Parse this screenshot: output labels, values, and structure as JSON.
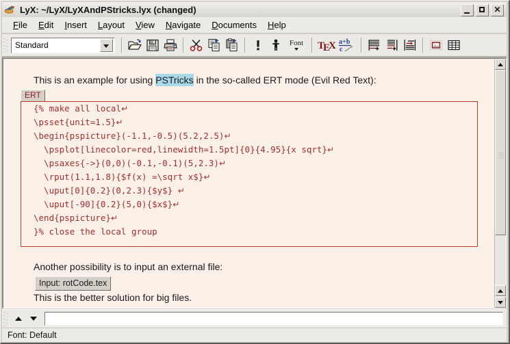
{
  "window": {
    "title": "LyX: ~/LyX/LyXAndPStricks.lyx (changed)",
    "icon": "lyx-logo-icon",
    "minimize_label": "–",
    "maximize_label": "□",
    "close_label": "✕"
  },
  "menubar": {
    "items": [
      {
        "label": "File",
        "accel": "F"
      },
      {
        "label": "Edit",
        "accel": "E"
      },
      {
        "label": "Insert",
        "accel": "I"
      },
      {
        "label": "Layout",
        "accel": "L"
      },
      {
        "label": "View",
        "accel": "V"
      },
      {
        "label": "Navigate",
        "accel": "N"
      },
      {
        "label": "Documents",
        "accel": "D"
      },
      {
        "label": "Help",
        "accel": "H"
      }
    ]
  },
  "toolbar": {
    "style_combo": {
      "value": "Standard",
      "icon": "chevron-down-icon"
    },
    "buttons": [
      {
        "name": "open-document-button",
        "tooltip": "Open"
      },
      {
        "name": "save-document-button",
        "tooltip": "Save"
      },
      {
        "name": "print-document-button",
        "tooltip": "Print"
      },
      {
        "name": "cut-button",
        "tooltip": "Cut"
      },
      {
        "name": "copy-button",
        "tooltip": "Copy"
      },
      {
        "name": "paste-button",
        "tooltip": "Paste"
      },
      {
        "name": "emphasize-button",
        "tooltip": "Emphasize"
      },
      {
        "name": "noun-button",
        "tooltip": "Noun"
      },
      {
        "name": "font-button",
        "tooltip": "Font",
        "label": "Font"
      },
      {
        "name": "tex-mode-button",
        "tooltip": "TeX mode",
        "label": "TeX"
      },
      {
        "name": "math-mode-button",
        "tooltip": "Math mode",
        "label": "a+b c"
      },
      {
        "name": "footnote-button",
        "tooltip": "Insert footnote"
      },
      {
        "name": "margin-note-button",
        "tooltip": "Insert margin note"
      },
      {
        "name": "insert-label-button",
        "tooltip": "Insert label"
      },
      {
        "name": "insert-graphics-button",
        "tooltip": "Insert graphics"
      },
      {
        "name": "insert-table-button",
        "tooltip": "Insert table"
      }
    ]
  },
  "document": {
    "intro": {
      "before": "This is an example for using ",
      "selected": "PSTricks",
      "after": " in the so-called ERT mode (Evil Red Text):"
    },
    "ert_label": "ERT",
    "ert_code_lines": [
      {
        "text": "{% make all local",
        "newline": true
      },
      {
        "text": "\\psset{unit=1.5}",
        "newline": true
      },
      {
        "text": "\\begin{pspicture}(-1.1,-0.5)(5.2,2.5)",
        "newline": true
      },
      {
        "text": "  \\psplot[linecolor=red,linewidth=1.5pt]{0}{4.95}{x sqrt}",
        "newline": true
      },
      {
        "text": "  \\psaxes{->}(0,0)(-0.1,-0.1)(5,2.3)",
        "newline": true
      },
      {
        "text": "  \\rput(1.1,1.8){$f(x) =\\sqrt x$}",
        "newline": true
      },
      {
        "text": "  \\uput[0]{0.2}(0,2.3){$y$} ",
        "newline": true
      },
      {
        "text": "  \\uput[-90]{0.2}(5,0){$x$}",
        "newline": true
      },
      {
        "text": "\\end{pspicture}",
        "newline": true
      },
      {
        "text": "}% close the local group",
        "newline": false
      }
    ],
    "another_possibility": "Another possibility is to input an external file:",
    "input_button_label": "Input: rotCode.tex",
    "better_solution": "This is the better solution for big files."
  },
  "minibuffer": {
    "value": "",
    "placeholder": "",
    "up_icon": "triangle-up-icon",
    "down_icon": "triangle-down-icon"
  },
  "statusbar": {
    "text": "Font: Default"
  },
  "scrollbar": {
    "up_icon": "scroll-up-icon",
    "down_icon": "scroll-down-icon"
  },
  "colors": {
    "ert_red": "#a03030",
    "ert_border": "#c0392b",
    "document_bg": "#faf0e8",
    "selection": "#a8d8ea",
    "chrome": "#eceae6"
  }
}
